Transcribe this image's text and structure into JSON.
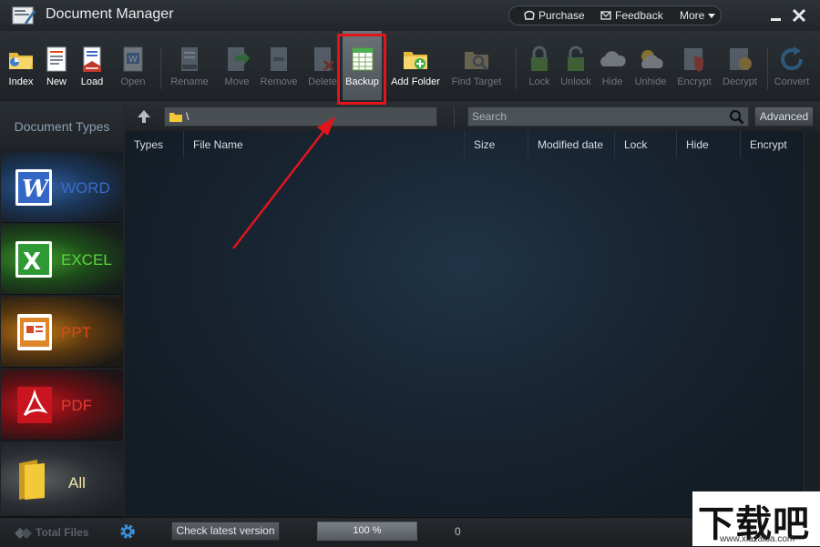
{
  "window": {
    "title": "Document Manager"
  },
  "topnav": {
    "purchase": "Purchase",
    "feedback": "Feedback",
    "more": "More"
  },
  "toolbar": {
    "index": "Index",
    "new": "New",
    "load": "Load",
    "open": "Open",
    "rename": "Rename",
    "move": "Move",
    "remove": "Remove",
    "delete": "Delete",
    "backup": "Backup",
    "add_folder": "Add Folder",
    "find_target": "Find Target",
    "lock": "Lock",
    "unlock": "Unlock",
    "hide": "Hide",
    "unhide": "Unhide",
    "encrypt": "Encrypt",
    "decrypt": "Decrypt",
    "convert": "Convert"
  },
  "sidebar": {
    "header": "Document Types",
    "items": [
      {
        "label": "WORD"
      },
      {
        "label": "EXCEL"
      },
      {
        "label": "PPT"
      },
      {
        "label": "PDF"
      },
      {
        "label": "All"
      }
    ]
  },
  "pathbar": {
    "path": "\\",
    "search_placeholder": "Search",
    "advanced": "Advanced"
  },
  "columns": [
    "Types",
    "File Name",
    "Size",
    "Modified date",
    "Lock",
    "Hide",
    "Encrypt"
  ],
  "status": {
    "total_files": "Total Files",
    "check_version": "Check latest version",
    "progress_text": "100 %",
    "progress_fraction": 1.0,
    "count": "0"
  },
  "watermark": {
    "main": "下载吧",
    "sub": "www.xiazaiba.com"
  },
  "colors": {
    "highlight": "#e0161b",
    "arrow": "#e0161b"
  }
}
